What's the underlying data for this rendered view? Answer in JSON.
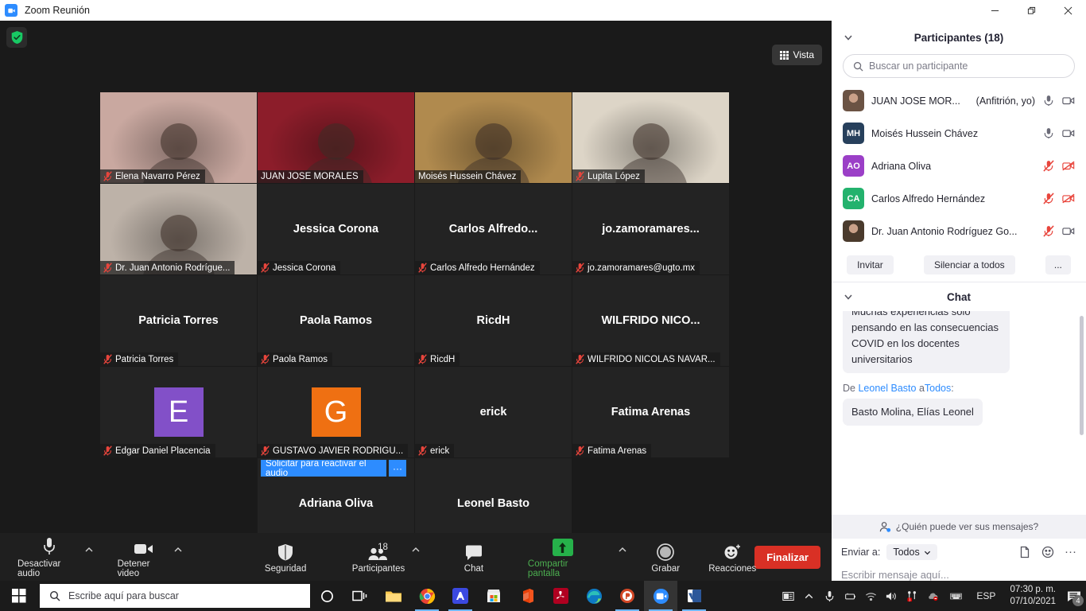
{
  "titlebar": {
    "title": "Zoom Reunión",
    "minimize": "—",
    "maximize": "❐",
    "close": "✕"
  },
  "stage": {
    "view_button": "Vista",
    "reactivate_audio": {
      "label": "Solicitar para reactivar el audio",
      "more": "···"
    },
    "tiles": [
      {
        "name": "Elena Navarro Pérez",
        "label": "Elena Navarro Pérez",
        "type": "video",
        "muted": true,
        "active": false,
        "bg": "#c9a8a0"
      },
      {
        "name": "JUAN JOSE MORALES",
        "label": "JUAN JOSE MORALES",
        "type": "video",
        "muted": false,
        "active": false,
        "bg": "#8c1d2a"
      },
      {
        "name": "Moisés Hussein Chávez",
        "label": "Moisés Hussein Chávez",
        "type": "video",
        "muted": false,
        "active": true,
        "bg": "#b08a4e"
      },
      {
        "name": "Lupita López",
        "label": "Lupita López",
        "type": "video",
        "muted": true,
        "active": false,
        "bg": "#ddd5c7"
      },
      {
        "name": "Dr. Juan Antonio Rodrígue...",
        "label": "Dr. Juan Antonio Rodrígue...",
        "type": "video",
        "muted": true,
        "active": false,
        "bg": "#bdb2a8"
      },
      {
        "name": "Jessica Corona",
        "label": "Jessica Corona",
        "display": "Jessica Corona",
        "type": "name",
        "muted": true,
        "active": false
      },
      {
        "name": "Carlos Alfredo Hernández",
        "label": "Carlos Alfredo Hernández",
        "display": "Carlos  Alfredo...",
        "type": "name",
        "muted": true,
        "active": false
      },
      {
        "name": "jo.zamoramares@ugto.mx",
        "label": "jo.zamoramares@ugto.mx",
        "display": "jo.zamoramares...",
        "type": "name",
        "muted": true,
        "active": false
      },
      {
        "name": "Patricia Torres",
        "label": "Patricia Torres",
        "display": "Patricia Torres",
        "type": "name",
        "muted": true,
        "active": false
      },
      {
        "name": "Paola Ramos",
        "label": "Paola Ramos",
        "display": "Paola Ramos",
        "type": "name",
        "muted": true,
        "active": false
      },
      {
        "name": "RicdH",
        "label": "RicdH",
        "display": "RicdH",
        "type": "name",
        "muted": true,
        "active": false
      },
      {
        "name": "WILFRIDO NICOLAS NAVAR...",
        "label": "WILFRIDO NICOLAS NAVAR...",
        "display": "WILFRIDO NICO...",
        "type": "name",
        "muted": true,
        "active": false
      },
      {
        "name": "Edgar Daniel Placencia",
        "label": "Edgar Daniel Placencia",
        "display": "E",
        "type": "avatar",
        "avatar_color": "#8250c8",
        "muted": true,
        "active": false
      },
      {
        "name": "GUSTAVO JAVIER RODRIGU...",
        "label": "GUSTAVO JAVIER RODRIGU...",
        "display": "G",
        "type": "avatar",
        "avatar_color": "#ef7012",
        "muted": true,
        "active": false
      },
      {
        "name": "erick",
        "label": "erick",
        "display": "erick",
        "type": "name",
        "muted": true,
        "active": false
      },
      {
        "name": "Fatima Arenas",
        "label": "Fatima Arenas",
        "display": "Fatima Arenas",
        "type": "name",
        "muted": true,
        "active": false
      },
      {
        "name": "empty-1",
        "label": "",
        "display": "",
        "type": "empty",
        "muted": false,
        "active": false
      },
      {
        "name": "Adriana Oliva",
        "label": "Adriana Oliva",
        "display": "Adriana Oliva",
        "type": "name",
        "muted": true,
        "active": false
      },
      {
        "name": "Leonel Basto",
        "label": "Leonel Basto",
        "display": "Leonel Basto",
        "type": "name",
        "muted": true,
        "active": false
      },
      {
        "name": "empty-2",
        "label": "",
        "display": "",
        "type": "empty",
        "muted": false,
        "active": false
      }
    ]
  },
  "toolbar": {
    "mute": "Desactivar audio",
    "video": "Detener video",
    "security": "Seguridad",
    "participants": "Participantes",
    "participants_count": "18",
    "chat": "Chat",
    "share": "Compartir pantalla",
    "record": "Grabar",
    "reactions": "Reacciones",
    "end": "Finalizar"
  },
  "panel": {
    "participants_title": "Participantes (18)",
    "search_placeholder": "Buscar un participante",
    "participants": [
      {
        "name": "JUAN JOSE MOR...",
        "host_tag": "(Anfitrión, yo)",
        "initials": "",
        "avatar_color": "#6b5344",
        "photo": true,
        "mic": "on",
        "cam": "on"
      },
      {
        "name": "Moisés Hussein Chávez",
        "host_tag": "",
        "initials": "MH",
        "avatar_color": "#27405c",
        "photo": false,
        "mic": "on",
        "cam": "on"
      },
      {
        "name": "Adriana Oliva",
        "host_tag": "",
        "initials": "AO",
        "avatar_color": "#9b3fc7",
        "photo": false,
        "mic": "off",
        "cam": "off"
      },
      {
        "name": "Carlos Alfredo Hernández",
        "host_tag": "",
        "initials": "CA",
        "avatar_color": "#23b26d",
        "photo": false,
        "mic": "off",
        "cam": "off"
      },
      {
        "name": "Dr. Juan Antonio Rodríguez Go...",
        "host_tag": "",
        "initials": "",
        "avatar_color": "#4a3a2c",
        "photo": true,
        "mic": "off",
        "cam": "on"
      }
    ],
    "actions": {
      "invite": "Invitar",
      "mute_all": "Silenciar a todos",
      "more": "..."
    },
    "chat_title": "Chat",
    "messages": [
      {
        "from": "",
        "to": "",
        "text": "Muchas experiencias solo pensando en las consecuencias COVID en los docentes universitarios",
        "clipped": true
      },
      {
        "from": "Leonel Basto",
        "to": "Todos",
        "prefix": "De",
        "mid": "a",
        "suffix": ":",
        "text": "Basto Molina, Elías Leonel",
        "clipped": false
      }
    ],
    "who_can_see": "¿Quién puede ver sus mensajes?",
    "send_to_label": "Enviar a:",
    "send_to_value": "Todos",
    "message_placeholder": "Escribir mensaje aquí..."
  },
  "taskbar": {
    "search_placeholder": "Escribe aquí para buscar",
    "language": "ESP",
    "time": "07:30 p. m.",
    "date": "07/10/2021",
    "notification_count": "4",
    "apps": [
      {
        "name": "cortana-icon"
      },
      {
        "name": "task-view-icon"
      },
      {
        "name": "file-explorer-icon"
      },
      {
        "name": "chrome-icon"
      },
      {
        "name": "blue-app-icon"
      },
      {
        "name": "microsoft-store-icon"
      },
      {
        "name": "office-icon"
      },
      {
        "name": "acrobat-reader-icon"
      },
      {
        "name": "edge-icon"
      },
      {
        "name": "powerpoint-icon"
      },
      {
        "name": "zoom-icon"
      },
      {
        "name": "word-icon"
      }
    ]
  },
  "colors": {
    "accent_blue": "#2d8cff",
    "end_red": "#d93025",
    "share_green": "#4caf50",
    "active_yellow": "#f3f32f"
  }
}
